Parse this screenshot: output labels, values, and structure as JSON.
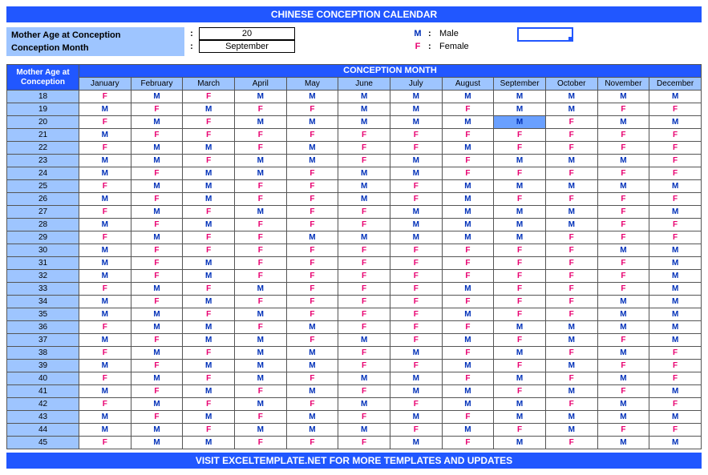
{
  "title": "CHINESE CONCEPTION CALENDAR",
  "footer": "VISIT EXCELTEMPLATE.NET FOR MORE TEMPLATES AND UPDATES",
  "controls": {
    "age_label": "Mother Age at Conception",
    "month_label": "Conception Month",
    "age_value": "20",
    "month_value": "September",
    "colon": ":"
  },
  "legend": {
    "m_sym": "M",
    "m_label": "Male",
    "f_sym": "F",
    "f_label": "Female",
    "colon": ":"
  },
  "table": {
    "corner": "Mother Age at Conception",
    "header": "CONCEPTION MONTH",
    "months": [
      "January",
      "February",
      "March",
      "April",
      "May",
      "June",
      "July",
      "August",
      "September",
      "October",
      "November",
      "December"
    ],
    "ages": [
      18,
      19,
      20,
      21,
      22,
      23,
      24,
      25,
      26,
      27,
      28,
      29,
      30,
      31,
      32,
      33,
      34,
      35,
      36,
      37,
      38,
      39,
      40,
      41,
      42,
      43,
      44,
      45
    ],
    "highlight": {
      "age": 20,
      "month": "September"
    },
    "data": {
      "18": [
        "F",
        "M",
        "F",
        "M",
        "M",
        "M",
        "M",
        "M",
        "M",
        "M",
        "M",
        "M"
      ],
      "19": [
        "M",
        "F",
        "M",
        "F",
        "F",
        "M",
        "M",
        "F",
        "M",
        "M",
        "F",
        "F"
      ],
      "20": [
        "F",
        "M",
        "F",
        "M",
        "M",
        "M",
        "M",
        "M",
        "M",
        "F",
        "M",
        "M"
      ],
      "21": [
        "M",
        "F",
        "F",
        "F",
        "F",
        "F",
        "F",
        "F",
        "F",
        "F",
        "F",
        "F"
      ],
      "22": [
        "F",
        "M",
        "M",
        "F",
        "M",
        "F",
        "F",
        "M",
        "F",
        "F",
        "F",
        "F"
      ],
      "23": [
        "M",
        "M",
        "F",
        "M",
        "M",
        "F",
        "M",
        "F",
        "M",
        "M",
        "M",
        "F"
      ],
      "24": [
        "M",
        "F",
        "M",
        "M",
        "F",
        "M",
        "M",
        "F",
        "F",
        "F",
        "F",
        "F"
      ],
      "25": [
        "F",
        "M",
        "M",
        "F",
        "F",
        "M",
        "F",
        "M",
        "M",
        "M",
        "M",
        "M"
      ],
      "26": [
        "M",
        "F",
        "M",
        "F",
        "F",
        "M",
        "F",
        "M",
        "F",
        "F",
        "F",
        "F"
      ],
      "27": [
        "F",
        "M",
        "F",
        "M",
        "F",
        "F",
        "M",
        "M",
        "M",
        "M",
        "F",
        "M"
      ],
      "28": [
        "M",
        "F",
        "M",
        "F",
        "F",
        "F",
        "M",
        "M",
        "M",
        "M",
        "F",
        "F"
      ],
      "29": [
        "F",
        "M",
        "F",
        "F",
        "M",
        "M",
        "M",
        "M",
        "M",
        "F",
        "F",
        "F"
      ],
      "30": [
        "M",
        "F",
        "F",
        "F",
        "F",
        "F",
        "F",
        "F",
        "F",
        "F",
        "M",
        "M"
      ],
      "31": [
        "M",
        "F",
        "M",
        "F",
        "F",
        "F",
        "F",
        "F",
        "F",
        "F",
        "F",
        "M"
      ],
      "32": [
        "M",
        "F",
        "M",
        "F",
        "F",
        "F",
        "F",
        "F",
        "F",
        "F",
        "F",
        "M"
      ],
      "33": [
        "F",
        "M",
        "F",
        "M",
        "F",
        "F",
        "F",
        "M",
        "F",
        "F",
        "F",
        "M"
      ],
      "34": [
        "M",
        "F",
        "M",
        "F",
        "F",
        "F",
        "F",
        "F",
        "F",
        "F",
        "M",
        "M"
      ],
      "35": [
        "M",
        "M",
        "F",
        "M",
        "F",
        "F",
        "F",
        "M",
        "F",
        "F",
        "M",
        "M"
      ],
      "36": [
        "F",
        "M",
        "M",
        "F",
        "M",
        "F",
        "F",
        "F",
        "M",
        "M",
        "M",
        "M"
      ],
      "37": [
        "M",
        "F",
        "M",
        "M",
        "F",
        "M",
        "F",
        "M",
        "F",
        "M",
        "F",
        "M"
      ],
      "38": [
        "F",
        "M",
        "F",
        "M",
        "M",
        "F",
        "M",
        "F",
        "M",
        "F",
        "M",
        "F"
      ],
      "39": [
        "M",
        "F",
        "M",
        "M",
        "M",
        "F",
        "F",
        "M",
        "F",
        "M",
        "F",
        "F"
      ],
      "40": [
        "F",
        "M",
        "F",
        "M",
        "F",
        "M",
        "M",
        "F",
        "M",
        "F",
        "M",
        "F"
      ],
      "41": [
        "M",
        "F",
        "M",
        "F",
        "M",
        "F",
        "M",
        "M",
        "F",
        "M",
        "F",
        "M"
      ],
      "42": [
        "F",
        "M",
        "F",
        "M",
        "F",
        "M",
        "F",
        "M",
        "M",
        "F",
        "M",
        "F"
      ],
      "43": [
        "M",
        "F",
        "M",
        "F",
        "M",
        "F",
        "M",
        "F",
        "M",
        "M",
        "M",
        "M"
      ],
      "44": [
        "M",
        "M",
        "F",
        "M",
        "M",
        "M",
        "F",
        "M",
        "F",
        "M",
        "F",
        "F"
      ],
      "45": [
        "F",
        "M",
        "M",
        "F",
        "F",
        "F",
        "M",
        "F",
        "M",
        "F",
        "M",
        "M"
      ]
    }
  }
}
